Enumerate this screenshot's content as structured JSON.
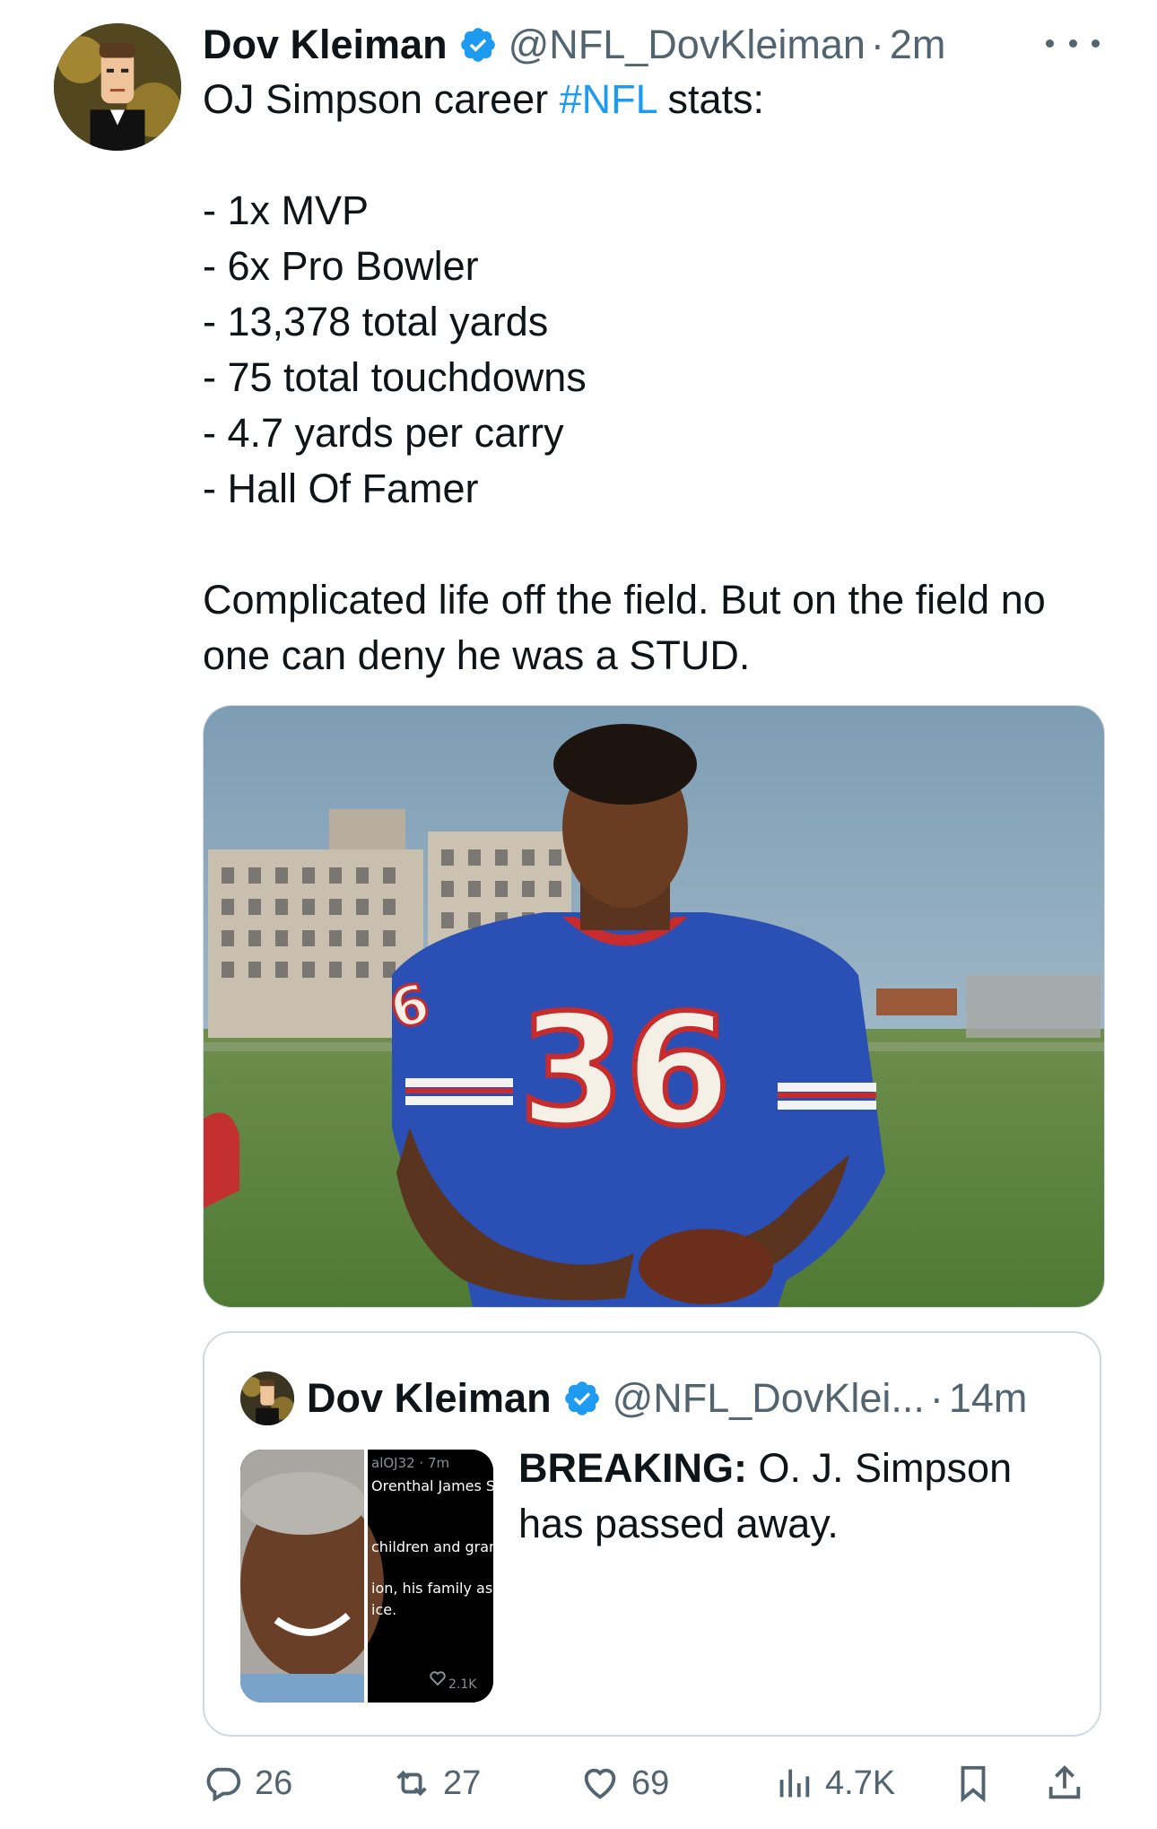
{
  "author": {
    "name": "Dov Kleiman",
    "handle": "@NFL_DovKleiman",
    "dot": "·",
    "time": "2m",
    "avatar_icon": "cartoon-avatar-icon",
    "verified_icon": "verified-badge-icon"
  },
  "tweet": {
    "line1_prefix": "OJ Simpson career ",
    "hashtag": "#NFL",
    "line1_suffix": " stats:",
    "stats": [
      "- 1x MVP",
      "- 6x Pro Bowler",
      "- 13,378 total yards",
      "- 75 total touchdowns",
      "- 4.7 yards per carry",
      "- Hall Of Famer"
    ],
    "closing": "Complicated life off the field. But on the field no one can deny he was a STUD."
  },
  "media": {
    "jersey_number": "36",
    "sleeve_number": "6"
  },
  "quote": {
    "name": "Dov Kleiman",
    "handle": "@NFL_DovKlei...",
    "dot": "·",
    "time": "14m",
    "breaking": "BREAKING:",
    "text": " O. J. Simpson has passed away.",
    "thumb": {
      "line1": "alOJ32 · 7m",
      "line2": "Orenthal James Si",
      "line3": "children and gran",
      "line4": "ion, his family ask",
      "line5": "ice.",
      "likes": "2.1K"
    }
  },
  "actions": {
    "replies": "26",
    "reposts": "27",
    "likes": "69",
    "views": "4.7K"
  },
  "colors": {
    "accent": "#1d9bf0",
    "secondary_text": "#536471",
    "border": "#cfd9de",
    "jersey_blue": "#2a4fb5"
  }
}
